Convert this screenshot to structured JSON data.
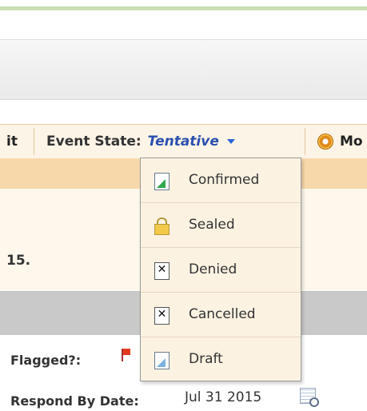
{
  "toolbar": {
    "left_fragment": "it",
    "event_state_label": "Event State:",
    "event_state_value": "Tentative",
    "more_fragment": "Mo"
  },
  "dropdown": {
    "items": [
      {
        "label": "Confirmed",
        "icon": "confirmed-doc-icon"
      },
      {
        "label": "Sealed",
        "icon": "lock-icon"
      },
      {
        "label": "Denied",
        "icon": "x-box-icon"
      },
      {
        "label": "Cancelled",
        "icon": "x-box-icon"
      },
      {
        "label": "Draft",
        "icon": "draft-doc-icon"
      }
    ]
  },
  "content": {
    "text_fragment": "15."
  },
  "fields": {
    "flagged_label": "Flagged?:",
    "respond_by_label": "Respond By Date:",
    "respond_by_value": "Jul 31 2015"
  },
  "colors": {
    "toolbar_bg": "#fcf4e6",
    "state_value": "#2a4fb0",
    "orange_band": "#f7d8ab",
    "dropdown_bg": "#fcf2e2"
  }
}
